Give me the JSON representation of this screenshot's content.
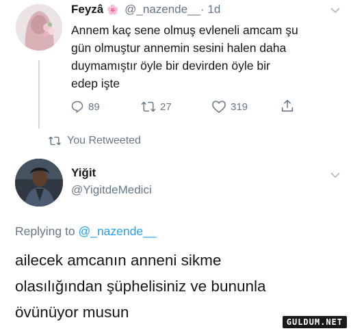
{
  "tweet1": {
    "display_name": "Feyzâ",
    "flower_emoji": "🌸",
    "handle": "@_nazende__",
    "time": "· 1d",
    "text_lines": [
      "Annem kaç sene olmuş evleneli amcam şu",
      "gün olmuştur annemin sesini halen daha",
      "duymamıştır öyle bir devirden öyle bir",
      "edep işte"
    ],
    "replies": "89",
    "retweets": "27",
    "likes": "319"
  },
  "retweet_notice": "You Retweeted",
  "tweet2": {
    "display_name": "Yiğit",
    "handle": "@YigitdeMedici",
    "replying_prefix": "Replying to",
    "replying_to": "@_nazende__",
    "text_lines": [
      "ailecek amcanın anneni sikme",
      "olasılığından şüphelisiniz ve bununla",
      "övünüyor musun"
    ]
  },
  "watermark": "GULDUM.NET",
  "colors": {
    "muted": "#657786",
    "link": "#1da1f2",
    "retweet_green": "#657786",
    "divider": "#ccd6dd"
  }
}
